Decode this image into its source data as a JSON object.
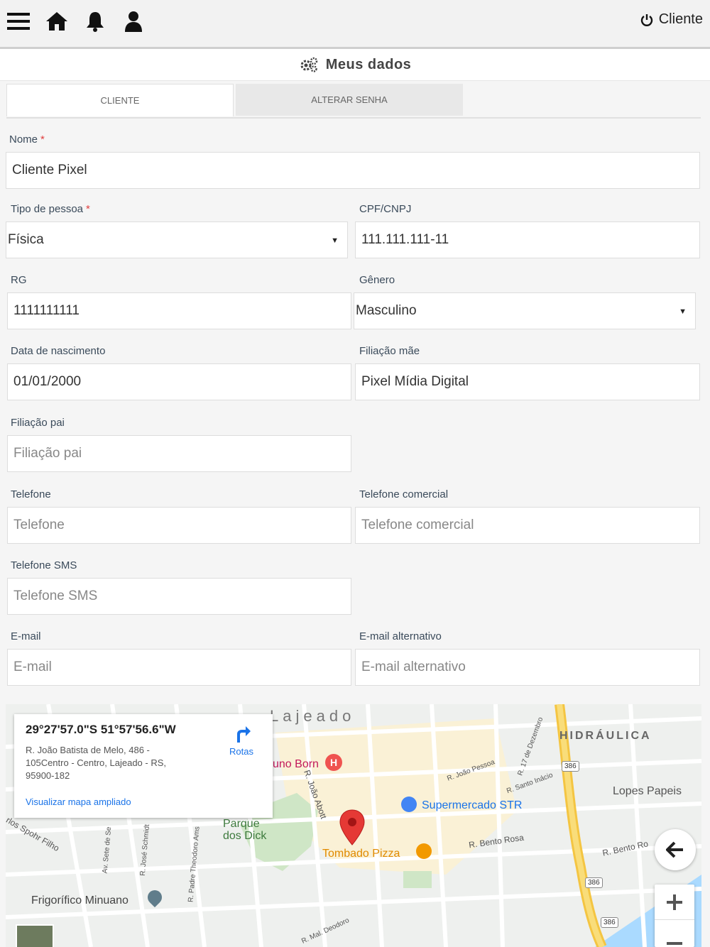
{
  "topbar": {
    "icons": [
      "menu-icon",
      "home-icon",
      "bell-icon",
      "user-icon"
    ],
    "user_label": "Cliente"
  },
  "page": {
    "title": "Meus dados"
  },
  "tabs": [
    {
      "label": "CLIENTE",
      "active": true
    },
    {
      "label": "ALTERAR SENHA",
      "active": false
    }
  ],
  "form": {
    "nome": {
      "label": "Nome",
      "required_mark": "*",
      "value": "Cliente Pixel"
    },
    "tipo_pessoa": {
      "label": "Tipo de pessoa",
      "required_mark": "*",
      "value": "Física"
    },
    "cpf_cnpj": {
      "label": "CPF/CNPJ",
      "value": "111.111.111-11"
    },
    "rg": {
      "label": "RG",
      "value": "1111111111"
    },
    "genero": {
      "label": "Gênero",
      "value": "Masculino"
    },
    "data_nascimento": {
      "label": "Data de nascimento",
      "value": "01/01/2000"
    },
    "filiacao_mae": {
      "label": "Filiação mãe",
      "value": "Pixel Mídia Digital"
    },
    "filiacao_pai": {
      "label": "Filiação pai",
      "placeholder": "Filiação pai"
    },
    "telefone": {
      "label": "Telefone",
      "placeholder": "Telefone"
    },
    "telefone_comercial": {
      "label": "Telefone comercial",
      "placeholder": "Telefone comercial"
    },
    "telefone_sms": {
      "label": "Telefone SMS",
      "placeholder": "Telefone SMS"
    },
    "email": {
      "label": "E-mail",
      "placeholder": "E-mail"
    },
    "email_alternativo": {
      "label": "E-mail alternativo",
      "placeholder": "E-mail alternativo"
    }
  },
  "map": {
    "coords": "29°27'57.0\"S 51°57'56.6\"W",
    "address": "R. João Batista de Melo, 486 - 105Centro - Centro, Lajeado - RS, 95900-182",
    "routes_label": "Rotas",
    "view_larger": "Visualizar mapa ampliado",
    "labels": {
      "city": "Lajeado",
      "district": "HIDRÁULICA",
      "bruno_born": "uno Born",
      "supermercado": "Supermercado STR",
      "tombado": "Tombado Pizza",
      "parque": "Parque dos Dick",
      "frigorifico": "Frigorífico Minuano",
      "lopes": "Lopes Papeis",
      "bento_rosa": "R. Bento Rosa",
      "bento_ro": "R. Bento Ro",
      "joao_abott": "R. João Abott",
      "joao_pessoa": "R. João Pessoa",
      "santo_inacio": "R. Santo Inácio",
      "dezembro": "R. 17 de Dezembro",
      "sete_set": "Av. Sete de Se",
      "jose_schmidt": "R. José Schmidt",
      "padre": "R. Padre Theodoro Ams",
      "spohr": "rlos Spohr Filho",
      "deodoro": "R. Mal. Deodoro",
      "road_386": "386"
    }
  },
  "colors": {
    "accent": "#1a73e8",
    "required": "#e04040",
    "pin": "#e53935"
  }
}
